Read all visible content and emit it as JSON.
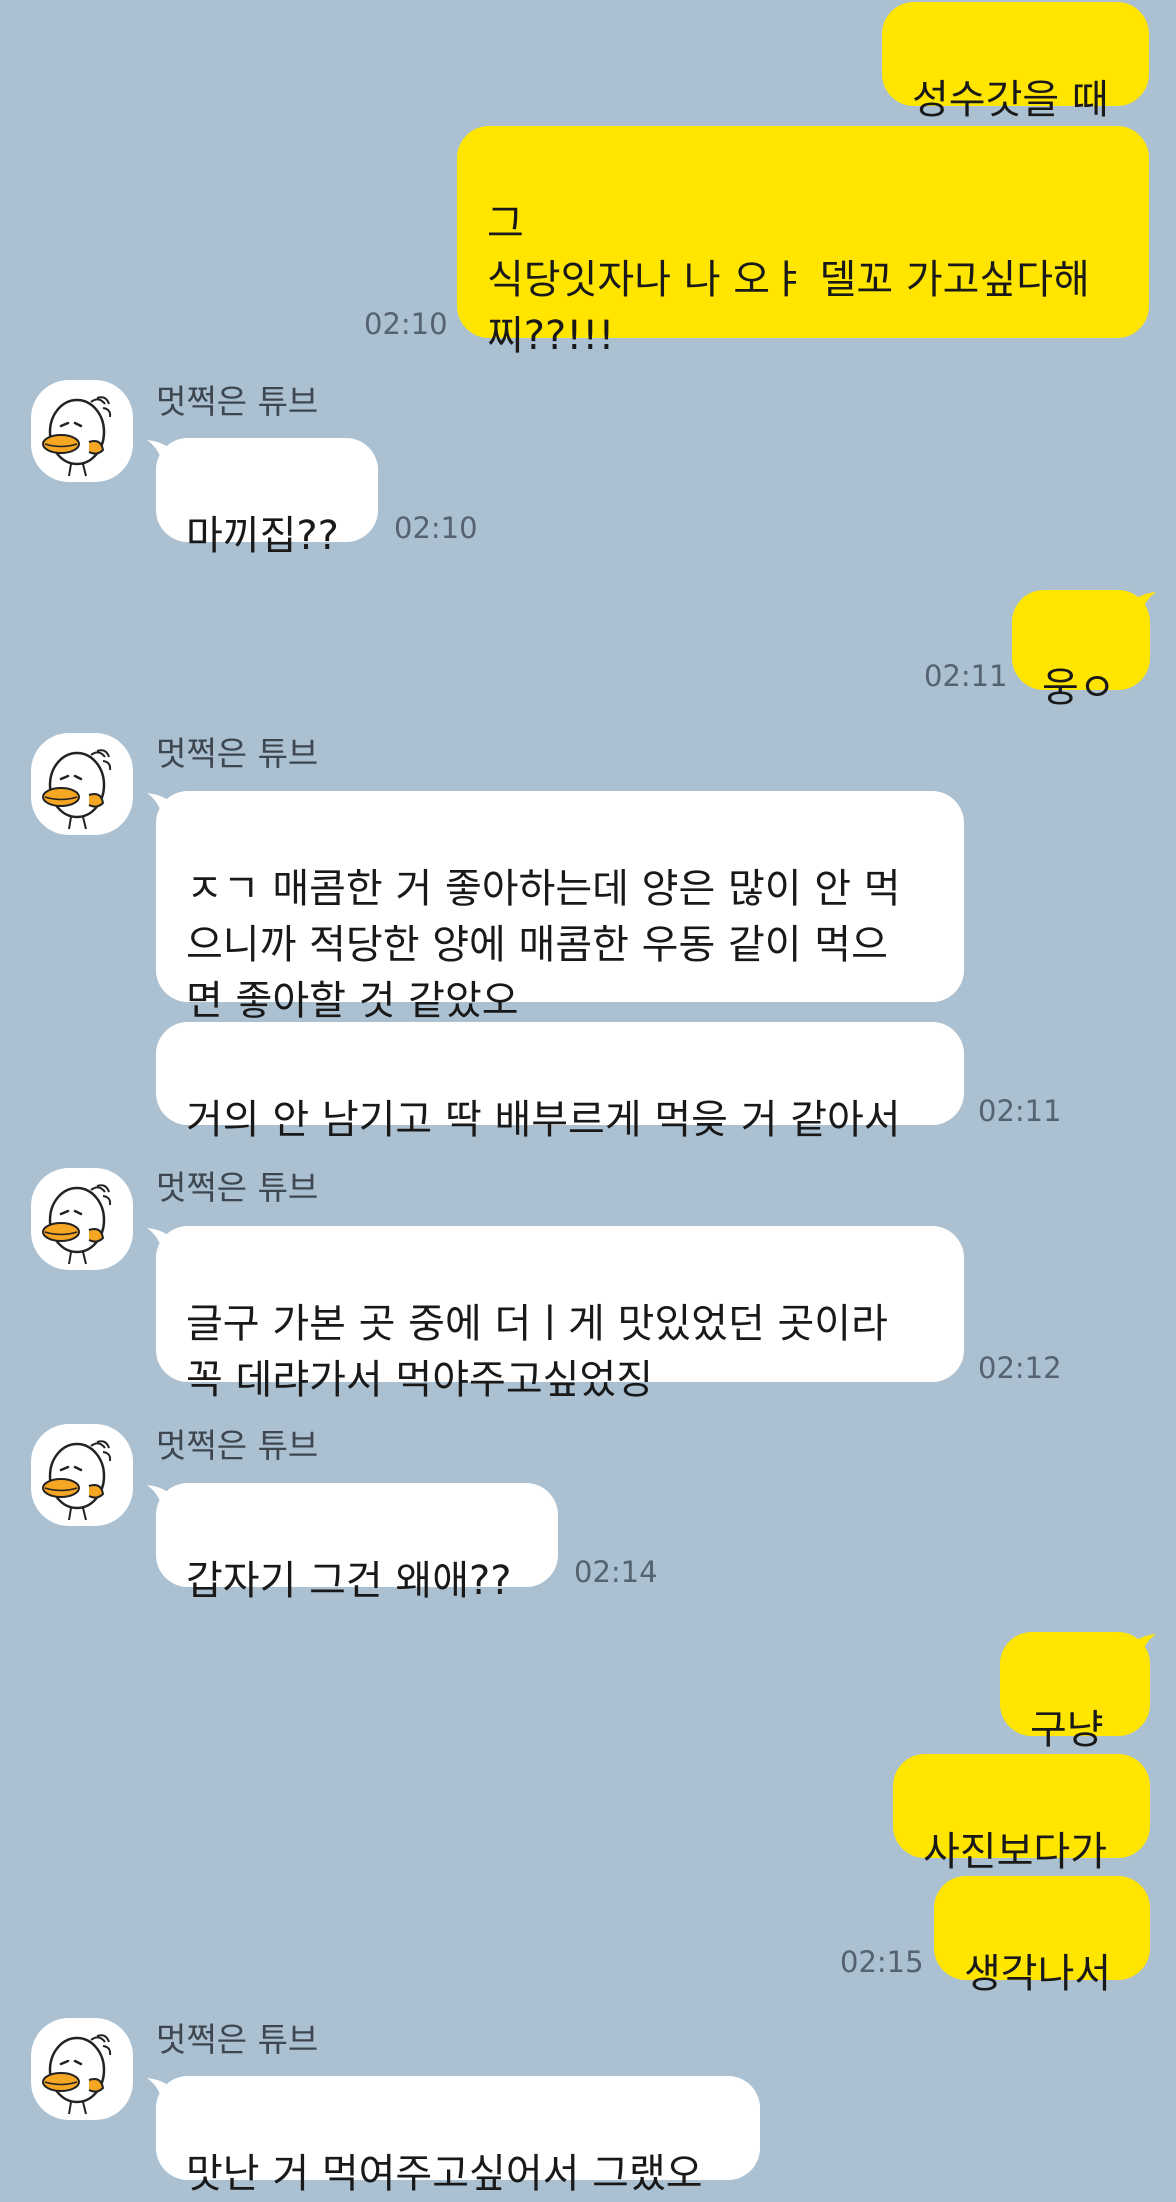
{
  "contact_name": "멋쩍은 튜브",
  "colors": {
    "background": "#abc1d1",
    "my_bubble": "#ffe500",
    "their_bubble": "#ffffff"
  },
  "avatar_icon": "tube-duck-character-icon",
  "messages": [
    {
      "sender": "me",
      "text": "성수갓을 때"
    },
    {
      "sender": "me",
      "text": "그\n식당잇자나 나 오ㅑ 델꼬 가고싶다해\n찌??!!!",
      "time": "02:10"
    },
    {
      "sender": "them",
      "name": "멋쩍은 튜브",
      "text": "마끼집??",
      "time": "02:10"
    },
    {
      "sender": "me",
      "text": "웅ㅇ",
      "time": "02:11"
    },
    {
      "sender": "them",
      "name": "멋쩍은 튜브",
      "text": "ㅈㄱ 매콤한 거 좋아하는데 양은 많이 안 먹\n으니까 적당한 양에 매콤한 우동 같이 먹으\n면 좋아할 것 같았오"
    },
    {
      "sender": "them",
      "text": "거의 안 남기고 딱 배부르게 먹읒 거 같아서",
      "time": "02:11"
    },
    {
      "sender": "them",
      "name": "멋쩍은 튜브",
      "text": "글구 가본 곳 중에 더ㅣ게 맛있었던 곳이라\n꼭 데랴가서 먹야주고싶었징",
      "time": "02:12"
    },
    {
      "sender": "them",
      "name": "멋쩍은 튜브",
      "text": "갑자기 그건 왜애??",
      "time": "02:14"
    },
    {
      "sender": "me",
      "text": "구냥"
    },
    {
      "sender": "me",
      "text": "사진보다가"
    },
    {
      "sender": "me",
      "text": "생각나서",
      "time": "02:15"
    },
    {
      "sender": "them",
      "name": "멋쩍은 튜브",
      "text": "맛난 거 먹여주고싶어서 그랬오"
    }
  ]
}
